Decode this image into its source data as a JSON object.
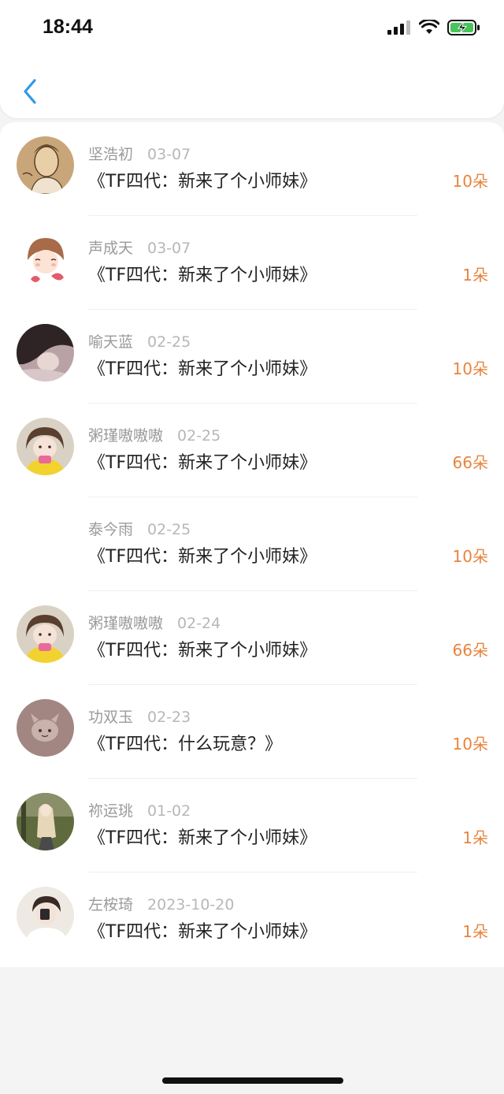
{
  "status_bar": {
    "time": "18:44"
  },
  "colors": {
    "accent": "#2f9ae6",
    "amount": "#e8843d",
    "battery": "#49c45a"
  },
  "rows": [
    {
      "name": "坚浩初",
      "date": "03-07",
      "title": "《TF四代：新来了个小师妹》",
      "amount": "10朵"
    },
    {
      "name": "声成天",
      "date": "03-07",
      "title": "《TF四代：新来了个小师妹》",
      "amount": "1朵"
    },
    {
      "name": "喻天蓝",
      "date": "02-25",
      "title": "《TF四代：新来了个小师妹》",
      "amount": "10朵"
    },
    {
      "name": "粥瑾嗷嗷嗷",
      "date": "02-25",
      "title": "《TF四代：新来了个小师妹》",
      "amount": "66朵"
    },
    {
      "name": "泰今雨",
      "date": "02-25",
      "title": "《TF四代：新来了个小师妹》",
      "amount": "10朵"
    },
    {
      "name": "粥瑾嗷嗷嗷",
      "date": "02-24",
      "title": "《TF四代：新来了个小师妹》",
      "amount": "66朵"
    },
    {
      "name": "功双玉",
      "date": "02-23",
      "title": "《TF四代：什么玩意？》",
      "amount": "10朵"
    },
    {
      "name": "祢运珧",
      "date": "01-02",
      "title": "《TF四代：新来了个小师妹》",
      "amount": "1朵"
    },
    {
      "name": "左桉琦",
      "date": "2023-10-20",
      "title": "《TF四代：新来了个小师妹》",
      "amount": "1朵"
    }
  ]
}
